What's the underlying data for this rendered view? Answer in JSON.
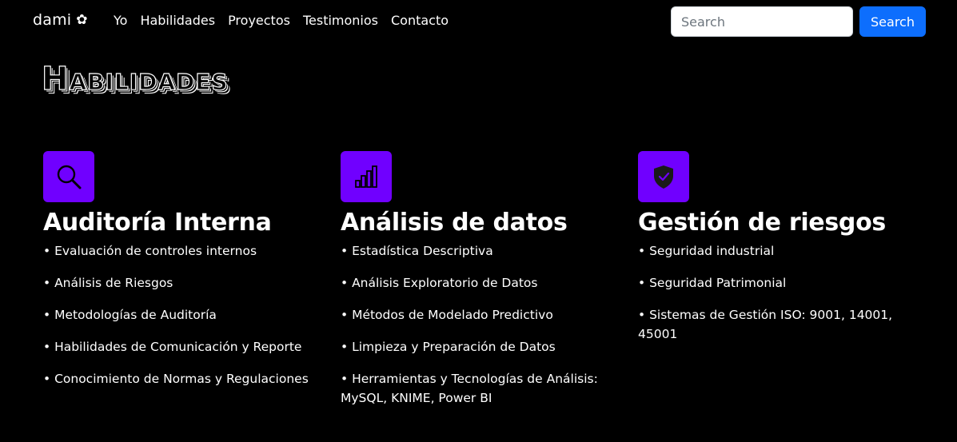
{
  "nav": {
    "brand": "dami",
    "brand_icon": "flower-icon",
    "links": [
      "Yo",
      "Habilidades",
      "Proyectos",
      "Testimonios",
      "Contacto"
    ],
    "search_placeholder": "Search",
    "search_button": "Search"
  },
  "section_title": "Habilidades",
  "colors": {
    "icon_bg": "#7000ff",
    "accent_button": "#0d6efd",
    "background": "#000000"
  },
  "columns": [
    {
      "icon": "magnifier-icon",
      "title": "Auditoría Interna",
      "items": [
        "• Evaluación de controles internos",
        "• Análisis de Riesgos",
        "• Metodologías de Auditoría",
        "• Habilidades de Comunicación y Reporte",
        "• Conocimiento de Normas y Regulaciones"
      ]
    },
    {
      "icon": "bar-chart-icon",
      "title": "Análisis de datos",
      "items": [
        "• Estadística Descriptiva",
        "• Análisis Exploratorio de Datos",
        "• Métodos de Modelado Predictivo",
        "• Limpieza y Preparación de Datos",
        "• Herramientas y Tecnologías de Análisis: MySQL, KNIME, Power BI"
      ]
    },
    {
      "icon": "shield-check-icon",
      "title": "Gestión de riesgos",
      "items": [
        "• Seguridad industrial",
        "• Seguridad Patrimonial",
        "• Sistemas de Gestión ISO: 9001, 14001, 45001"
      ]
    }
  ]
}
